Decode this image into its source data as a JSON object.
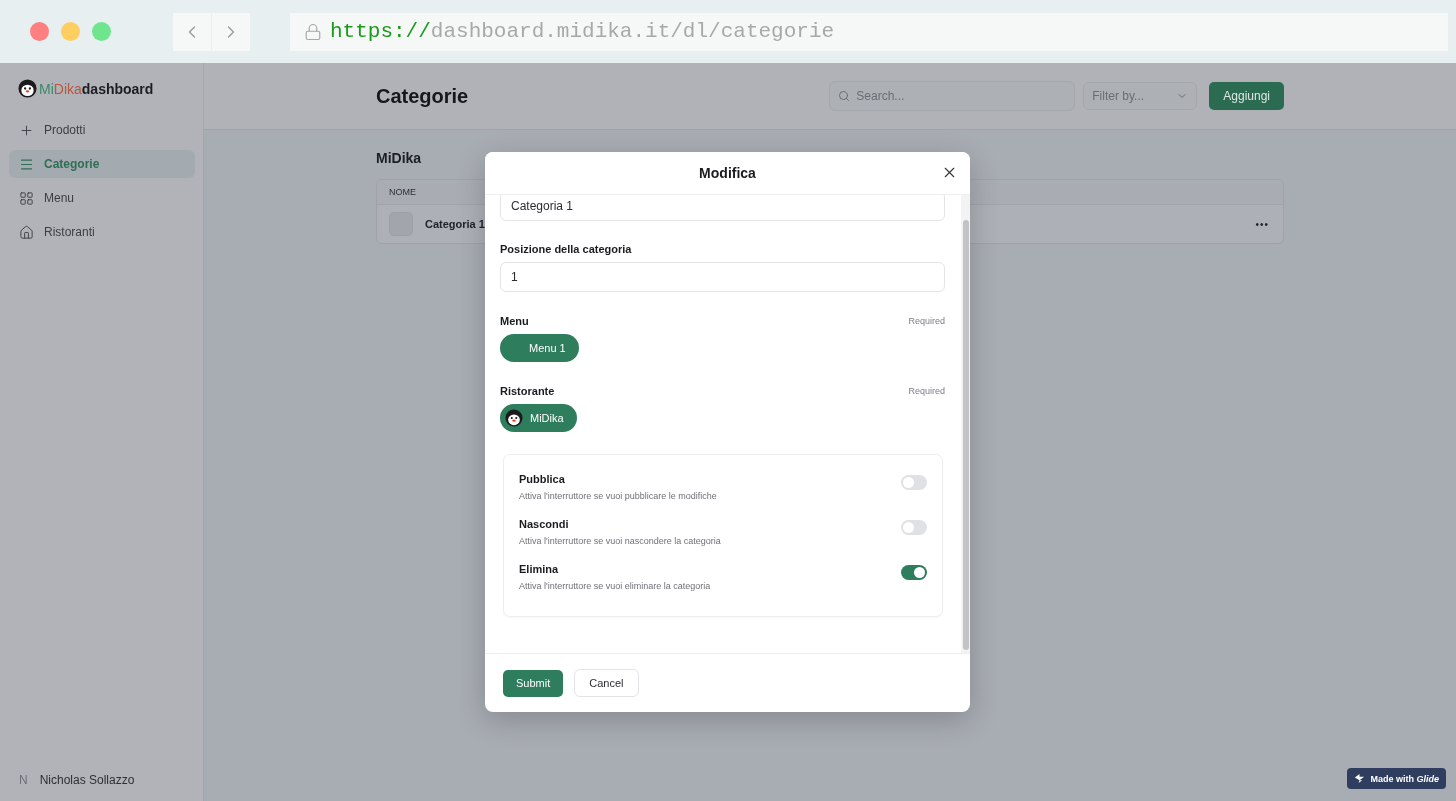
{
  "browser": {
    "url_scheme": "https://",
    "url_rest": "dashboard.midika.it/dl/categorie"
  },
  "logo": {
    "parts": [
      "Mi",
      "Dika",
      "dashboard"
    ]
  },
  "sidebar": {
    "items": [
      {
        "label": "Prodotti",
        "selected": false
      },
      {
        "label": "Categorie",
        "selected": true
      },
      {
        "label": "Menu",
        "selected": false
      },
      {
        "label": "Ristoranti",
        "selected": false
      }
    ],
    "user": {
      "initial": "N",
      "name": "Nicholas Sollazzo"
    }
  },
  "header": {
    "title": "Categorie",
    "search": {
      "placeholder": "Search..."
    },
    "filter": {
      "placeholder": "Filter by..."
    },
    "add_button": "Aggiungi"
  },
  "section": {
    "title": "MiDika",
    "table": {
      "columns": [
        "NOME"
      ],
      "rows": [
        {
          "name": "Categoria 1",
          "more": "•••"
        }
      ]
    }
  },
  "dialog": {
    "title": "Modifica",
    "name_field": {
      "value": "Categoria 1"
    },
    "position_field": {
      "label": "Posizione della categoria",
      "value": "1"
    },
    "relations": [
      {
        "label": "Menu",
        "note": "Required",
        "chip": "Menu 1",
        "avatar": false
      },
      {
        "label": "Ristorante",
        "note": "Required",
        "chip": "MiDika",
        "avatar": true
      }
    ],
    "switches": [
      {
        "label": "Pubblica",
        "description": "Attiva l'interruttore se vuoi pubblicare le modifiche",
        "on": false
      },
      {
        "label": "Nascondi",
        "description": "Attiva l'interruttore se vuoi nascondere la categoria",
        "on": false
      },
      {
        "label": "Elimina",
        "description": "Attiva l'interruttore se vuoi eliminare la categoria",
        "on": true
      }
    ],
    "submit": "Submit",
    "cancel": "Cancel"
  },
  "badge": {
    "prefix": "Made with",
    "brand": "Glide"
  }
}
